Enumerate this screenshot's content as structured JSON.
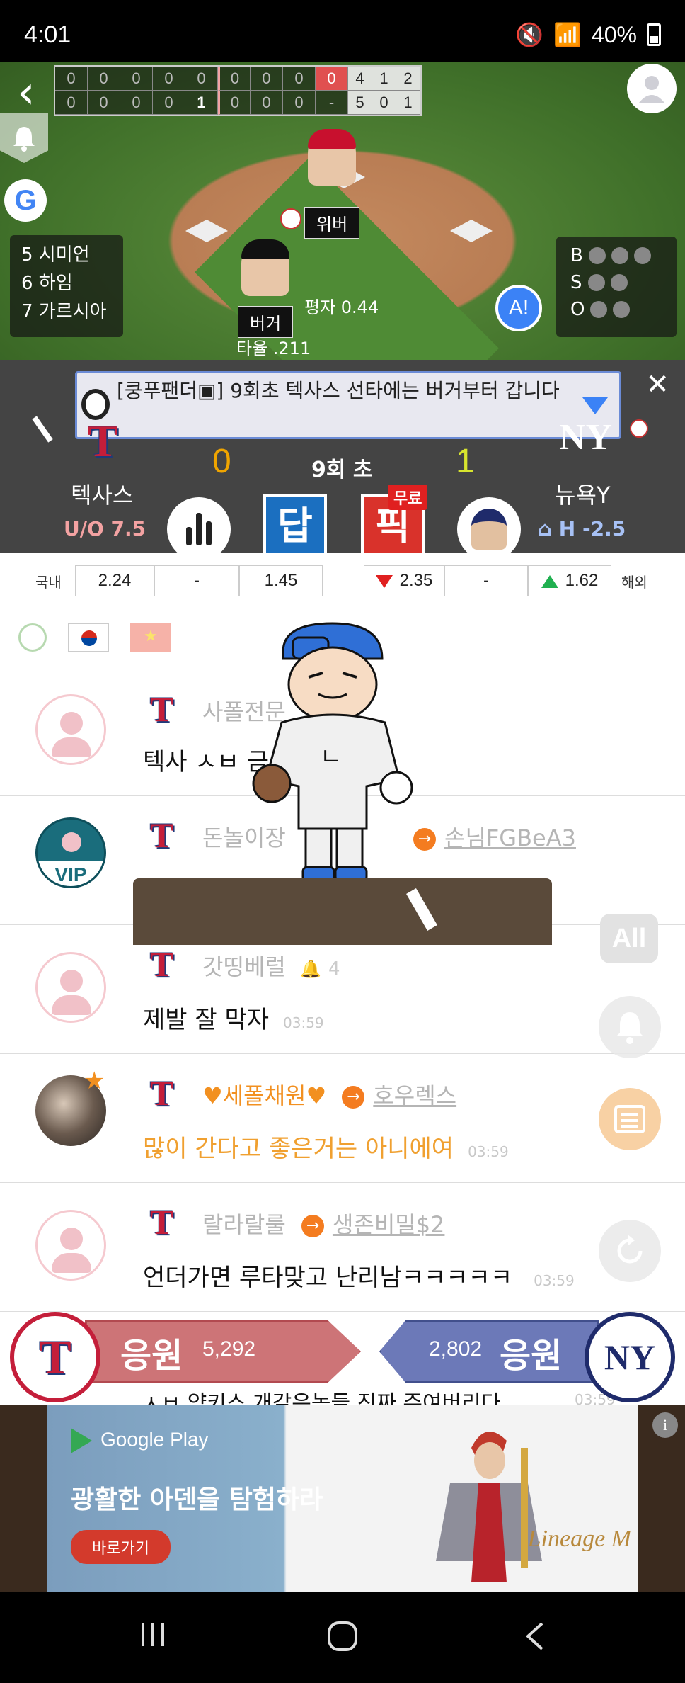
{
  "status": {
    "time": "4:01",
    "battery": "40%"
  },
  "scoreboard": {
    "top": [
      "0",
      "0",
      "0",
      "0",
      "0",
      "0",
      "0",
      "0",
      "0"
    ],
    "bottom": [
      "0",
      "0",
      "0",
      "0",
      "1",
      "0",
      "0",
      "0",
      "-"
    ],
    "rhe_top": [
      "4",
      "1",
      "2"
    ],
    "rhe_bottom": [
      "5",
      "0",
      "1"
    ]
  },
  "lineup": [
    "5 시미언",
    "6 하임",
    "7 가르시아"
  ],
  "count": {
    "b": "B",
    "s": "S",
    "o": "O"
  },
  "pitcher": {
    "tag": "위버",
    "stat": "평자 0.44"
  },
  "batter": {
    "tag": "버거",
    "stat": "타율 .211"
  },
  "ai_badge": "A!",
  "notice": "[쿵푸팬더▣] 9회초 텍사스 선타에는 버거부터 갑니다",
  "game": {
    "home": {
      "name": "텍사스",
      "score": "0",
      "line": "U/O 7.5",
      "logo": "T"
    },
    "away": {
      "name": "뉴욕Y",
      "score": "1",
      "line": "H -2.5",
      "logo": "NY"
    },
    "inning": "9회 초",
    "dap": "답",
    "pik": "픽",
    "pik_free": "무료"
  },
  "odds": {
    "domestic_label": "국내",
    "overseas_label": "해외",
    "domestic": [
      "2.24",
      "-",
      "1.45"
    ],
    "overseas": [
      "2.35",
      "-",
      "1.62"
    ]
  },
  "messages": [
    {
      "nick": "사폴전문",
      "text": "텍사 ㅅㅂ 금",
      "time": ""
    },
    {
      "nick": "돈놀이장",
      "target": "손님FGBeA3",
      "text": "",
      "time": ""
    },
    {
      "nick": "갓띵베럴",
      "bell_count": "4",
      "text": "제발 잘 막자",
      "time": "03:59"
    },
    {
      "nick": "♥세폴채원♥",
      "target": "호우렉스",
      "text": "많이 간다고 좋은거는 아니에여",
      "time": "03:59"
    },
    {
      "nick": "랄라랄룰",
      "target": "생존비밀$2",
      "text": "언더가면 루타맞고 난리남ㅋㅋㅋㅋㅋ",
      "time": "03:59"
    }
  ],
  "side": {
    "all": "All"
  },
  "cheer": {
    "home_word": "응원",
    "home_count": "5,292",
    "away_word": "응원",
    "away_count": "2,802",
    "peek_text": "ㅅㅂ 양키스 개같은놈들 진짜 주여버리다",
    "peek_time": "03:59"
  },
  "ad": {
    "store": "Google Play",
    "headline": "광활한 아덴을 탐험하라",
    "cta": "바로가기",
    "brand": "Lineage M",
    "info": "i"
  },
  "colors": {
    "rangers_red": "#c41e3a",
    "yankees_navy": "#1f2b6b",
    "accent_orange": "#f29020"
  }
}
